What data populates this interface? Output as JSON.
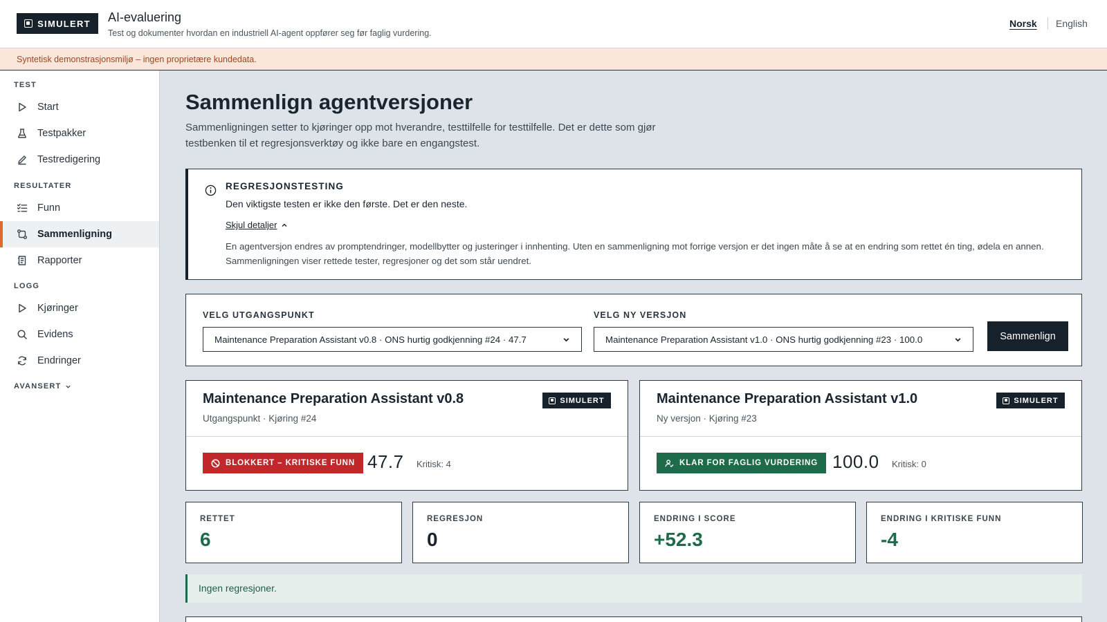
{
  "header": {
    "brand_badge": "SIMULERT",
    "title": "AI-evaluering",
    "subtitle": "Test og dokumenter hvordan en industriell AI-agent oppfører seg før faglig vurdering.",
    "lang_active": "Norsk",
    "lang_other": "English"
  },
  "banner": "Syntetisk demonstrasjonsmiljø – ingen proprietære kundedata.",
  "sidebar": {
    "sections": [
      {
        "title": "TEST"
      },
      {
        "title": "RESULTATER"
      },
      {
        "title": "LOGG"
      },
      {
        "title": "AVANSERT"
      }
    ],
    "items": [
      {
        "label": "Start",
        "icon": "play-icon"
      },
      {
        "label": "Testpakker",
        "icon": "flask-icon"
      },
      {
        "label": "Testredigering",
        "icon": "pencil-icon"
      },
      {
        "label": "Funn",
        "icon": "checklist-icon"
      },
      {
        "label": "Sammenligning",
        "icon": "compare-icon",
        "active": true
      },
      {
        "label": "Rapporter",
        "icon": "report-icon"
      },
      {
        "label": "Kjøringer",
        "icon": "play-icon"
      },
      {
        "label": "Evidens",
        "icon": "search-icon"
      },
      {
        "label": "Endringer",
        "icon": "refresh-icon"
      }
    ]
  },
  "main": {
    "title": "Sammenlign agentversjoner",
    "description": "Sammenligningen setter to kjøringer opp mot hverandre, testtilfelle for testtilfelle. Det er dette som gjør testbenken til et regresjonsverktøy og ikke bare en engangstest.",
    "info": {
      "heading": "REGRESJONSTESTING",
      "lead": "Den viktigste testen er ikke den første. Det er den neste.",
      "toggle": "Skjul detaljer",
      "body": "En agentversjon endres av promptendringer, modellbytter og justeringer i innhenting. Uten en sammenligning mot forrige versjon er det ingen måte å se at en endring som rettet én ting, ødela en annen. Sammenligningen viser rettede tester, regresjoner og det som står uendret."
    },
    "selectors": {
      "baseline_label": "VELG UTGANGSPUNKT",
      "baseline_value": "Maintenance Preparation Assistant v0.8 · ONS hurtig godkjenning #24 · 47.7",
      "new_label": "VELG NY VERSJON",
      "new_value": "Maintenance Preparation Assistant v1.0 · ONS hurtig godkjenning #23 · 100.0",
      "compare_button": "Sammenlign"
    },
    "cards": [
      {
        "title": "Maintenance Preparation Assistant v0.8",
        "subtitle": "Utgangspunkt · Kjøring #24",
        "badge": "SIMULERT",
        "status": "BLOKKERT – KRITISKE FUNN",
        "status_color": "#c0282b",
        "score": "47.7",
        "critical": "Kritisk: 4"
      },
      {
        "title": "Maintenance Preparation Assistant v1.0",
        "subtitle": "Ny versjon · Kjøring #23",
        "badge": "SIMULERT",
        "status": "KLAR FOR FAGLIG VURDERING",
        "status_color": "#1d6b4a",
        "score": "100.0",
        "critical": "Kritisk: 0"
      }
    ],
    "metrics": [
      {
        "label": "RETTET",
        "value": "6",
        "color": "#1d6b4a"
      },
      {
        "label": "REGRESJON",
        "value": "0",
        "color": "#1b2530"
      },
      {
        "label": "ENDRING I SCORE",
        "value": "+52.3",
        "color": "#1d6b4a"
      },
      {
        "label": "ENDRING I KRITISKE FUNN",
        "value": "-4",
        "color": "#1d6b4a"
      }
    ],
    "success_note": "Ingen regresjoner."
  }
}
